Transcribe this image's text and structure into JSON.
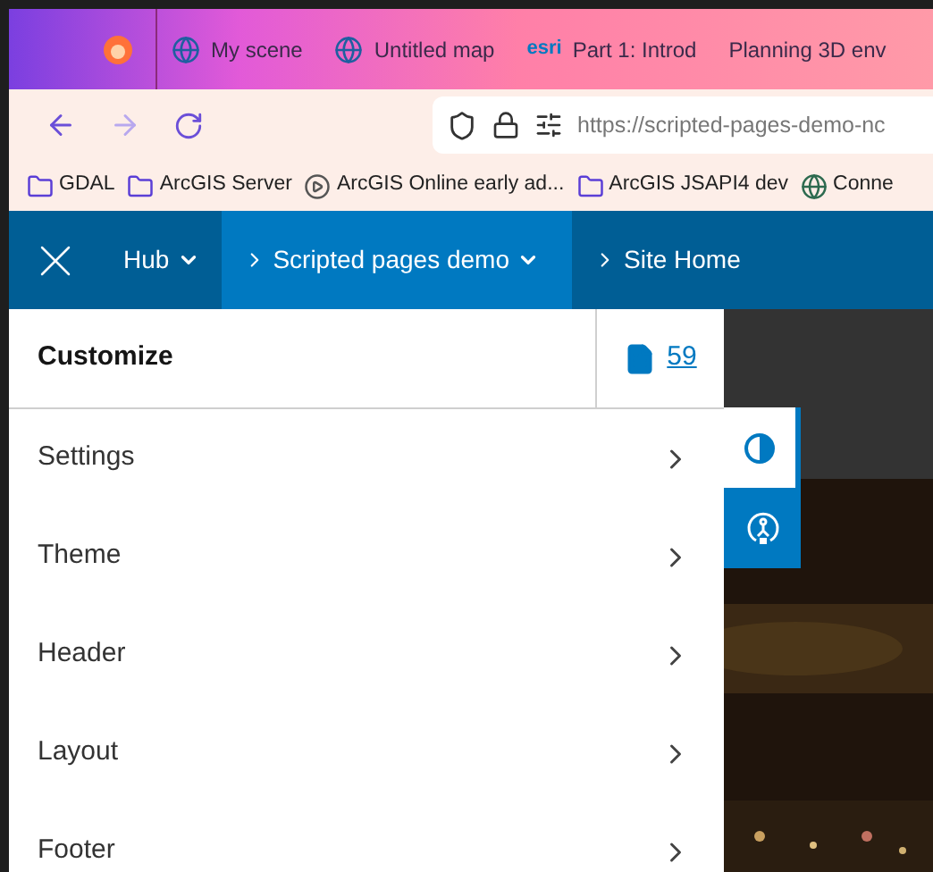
{
  "browser": {
    "tabs": [
      {
        "kind": "globe",
        "title": "My scene"
      },
      {
        "kind": "globe",
        "title": "Untitled map"
      },
      {
        "kind": "logo",
        "logo_text": "esri",
        "title": "Part 1: Introd"
      },
      {
        "kind": "plain",
        "title": "Planning 3D env"
      }
    ],
    "url": "https://scripted-pages-demo-nc",
    "bookmarks": [
      {
        "kind": "folder",
        "label": "GDAL"
      },
      {
        "kind": "folder",
        "label": "ArcGIS Server"
      },
      {
        "kind": "play",
        "label": "ArcGIS Online early ad..."
      },
      {
        "kind": "folder",
        "label": "ArcGIS JSAPI4 dev"
      },
      {
        "label": "Conne"
      }
    ]
  },
  "header": {
    "items": [
      {
        "label": "Hub",
        "chevron": false,
        "dropdown": true,
        "selected": false
      },
      {
        "label": "Scripted pages demo",
        "chevron": true,
        "dropdown": true,
        "selected": true
      },
      {
        "label": "Site Home",
        "chevron": true,
        "dropdown": false,
        "selected": false
      }
    ]
  },
  "panel": {
    "title": "Customize",
    "count": "59",
    "items": [
      {
        "label": "Settings"
      },
      {
        "label": "Theme"
      },
      {
        "label": "Header"
      },
      {
        "label": "Layout"
      },
      {
        "label": "Footer"
      }
    ]
  },
  "side_buttons": [
    {
      "kind": "contrast",
      "selected": true
    },
    {
      "kind": "accessibility",
      "selected": false
    }
  ]
}
